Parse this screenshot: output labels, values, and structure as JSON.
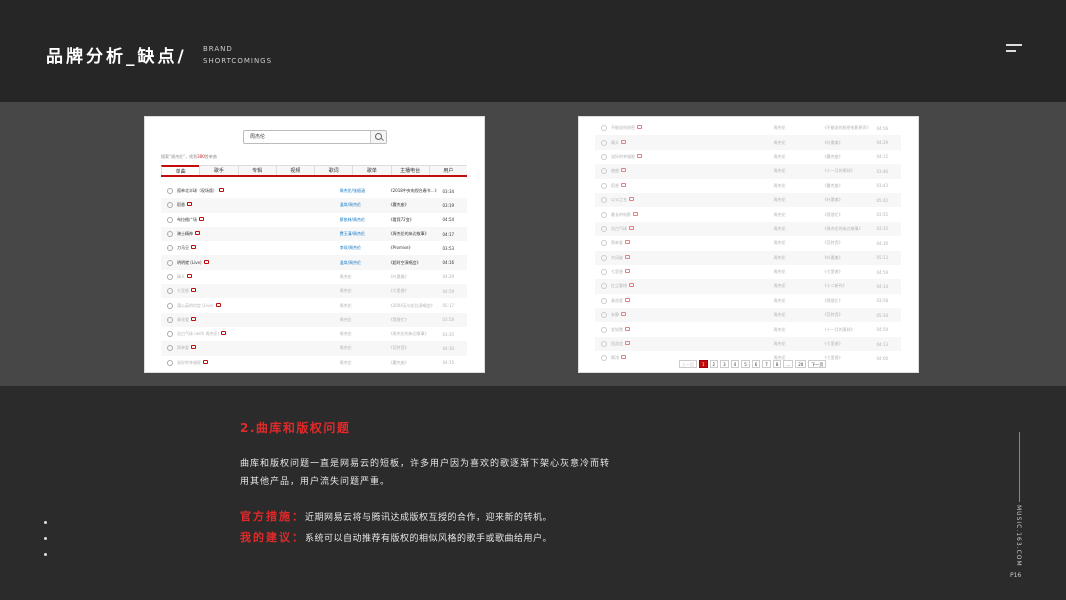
{
  "header": {
    "title": "品牌分析_缺点/",
    "subtitle_line1": "BRAND",
    "subtitle_line2": "SHORTCOMINGS"
  },
  "left_screenshot": {
    "search_query": "周杰伦",
    "found_text": "搜索“周杰伦”，找到",
    "found_count": "300",
    "found_unit": "首单曲",
    "tabs": [
      "单曲",
      "歌手",
      "专辑",
      "视频",
      "歌词",
      "歌单",
      "主播电台",
      "用户"
    ],
    "rows": [
      {
        "name": "孤单北半球（现场版）",
        "artist": "周杰伦/张韶涵",
        "album": "《2018中央电视台春节...》",
        "duration": "03:34",
        "gray": false,
        "artist_blue": true
      },
      {
        "name": "稻香",
        "artist": "温岚/周杰伦",
        "album": "《魔杰座》",
        "duration": "03:19",
        "gray": false,
        "artist_blue": true
      },
      {
        "name": "布拉格广场",
        "artist": "蔡依林/周杰伦",
        "album": "《看我72变》",
        "duration": "04:54",
        "gray": false,
        "artist_blue": true
      },
      {
        "name": "骑士精神",
        "artist": "费玉清/周杰伦",
        "album": "《周杰伦的床边故事》",
        "duration": "04:17",
        "gray": false,
        "artist_blue": true
      },
      {
        "name": "刀马旦",
        "artist": "李玟/周杰伦",
        "album": "《Promise》",
        "duration": "03:53",
        "gray": false,
        "artist_blue": true
      },
      {
        "name": "明明就 (Live)",
        "artist": "温岚/周杰伦",
        "album": "《超时空演唱会》",
        "duration": "04:16",
        "gray": false,
        "artist_blue": true
      },
      {
        "name": "晴天",
        "artist": "周杰伦",
        "album": "《叶惠美》",
        "duration": "04:29",
        "gray": true,
        "artist_blue": false
      },
      {
        "name": "七里香",
        "artist": "周杰伦",
        "album": "《七里香》",
        "duration": "04:59",
        "gray": true,
        "artist_blue": false
      },
      {
        "name": "蒲公英的约定 (Live)",
        "artist": "周杰伦",
        "album": "《2004无与伦比演唱会》",
        "duration": "05:17",
        "gray": true,
        "artist_blue": false
      },
      {
        "name": "青花瓷",
        "artist": "周杰伦",
        "album": "《我很忙》",
        "duration": "03:58",
        "gray": true,
        "artist_blue": false
      },
      {
        "name": "告白气球 (with 周杰伦)",
        "artist": "周杰伦",
        "album": "《周杰伦的床边故事》",
        "duration": "03:35",
        "gray": true,
        "artist_blue": false
      },
      {
        "name": "简单爱",
        "artist": "周杰伦",
        "album": "《范特西》",
        "duration": "04:30",
        "gray": true,
        "artist_blue": false
      },
      {
        "name": "说好的幸福呢",
        "artist": "周杰伦",
        "album": "《魔杰座》",
        "duration": "04:15",
        "gray": true,
        "artist_blue": false
      }
    ]
  },
  "right_screenshot": {
    "rows": [
      {
        "name": "不能说的秘密",
        "artist": "周杰伦",
        "album": "《不能说的秘密电影原声》",
        "duration": "04:56"
      },
      {
        "name": "晴天",
        "artist": "周杰伦",
        "album": "《叶惠美》",
        "duration": "04:29"
      },
      {
        "name": "说好的幸福呢",
        "artist": "周杰伦",
        "album": "《魔杰座》",
        "duration": "04:15"
      },
      {
        "name": "夜曲",
        "artist": "周杰伦",
        "album": "《十一月的萧邦》",
        "duration": "03:46"
      },
      {
        "name": "稻香",
        "artist": "周杰伦",
        "album": "《魔杰座》",
        "duration": "03:43"
      },
      {
        "name": "以父之名",
        "artist": "周杰伦",
        "album": "《叶惠美》",
        "duration": "05:42"
      },
      {
        "name": "最长的电影",
        "artist": "周杰伦",
        "album": "《我很忙》",
        "duration": "03:55"
      },
      {
        "name": "告白气球",
        "artist": "周杰伦",
        "album": "《周杰伦的床边故事》",
        "duration": "03:35"
      },
      {
        "name": "简单爱",
        "artist": "周杰伦",
        "album": "《范特西》",
        "duration": "04:30"
      },
      {
        "name": "东风破",
        "artist": "周杰伦",
        "album": "《叶惠美》",
        "duration": "05:13"
      },
      {
        "name": "七里香",
        "artist": "周杰伦",
        "album": "《七里香》",
        "duration": "04:59"
      },
      {
        "name": "红尘客栈",
        "artist": "周杰伦",
        "album": "《十二新作》",
        "duration": "04:34"
      },
      {
        "name": "青花瓷",
        "artist": "周杰伦",
        "album": "《我很忙》",
        "duration": "03:58"
      },
      {
        "name": "安静",
        "artist": "周杰伦",
        "album": "《范特西》",
        "duration": "05:34"
      },
      {
        "name": "发如雪",
        "artist": "周杰伦",
        "album": "《十一月的萧邦》",
        "duration": "04:59"
      },
      {
        "name": "园游会",
        "artist": "周杰伦",
        "album": "《七里香》",
        "duration": "04:13"
      },
      {
        "name": "搁浅",
        "artist": "周杰伦",
        "album": "《七里香》",
        "duration": "04:00"
      }
    ],
    "pager": [
      "上一页",
      "1",
      "2",
      "3",
      "4",
      "5",
      "6",
      "7",
      "8",
      "...",
      "20",
      "下一页"
    ]
  },
  "section": {
    "title": "2.曲库和版权问题",
    "paragraph": "曲库和版权问题一直是网易云的短板，许多用户因为喜欢的歌逐渐下架心灰意冷而转用其他产品，用户流失问题严重。",
    "official_label": "官方措施：",
    "official_text": "近期网易云将与腾讯达成版权互授的合作，迎来新的转机。",
    "suggest_label": "我的建议：",
    "suggest_text": "系统可以自动推荐有版权的相似风格的歌手或歌曲给用户。"
  },
  "side": {
    "site": "MUSIC.163.COM",
    "page": "P16"
  }
}
